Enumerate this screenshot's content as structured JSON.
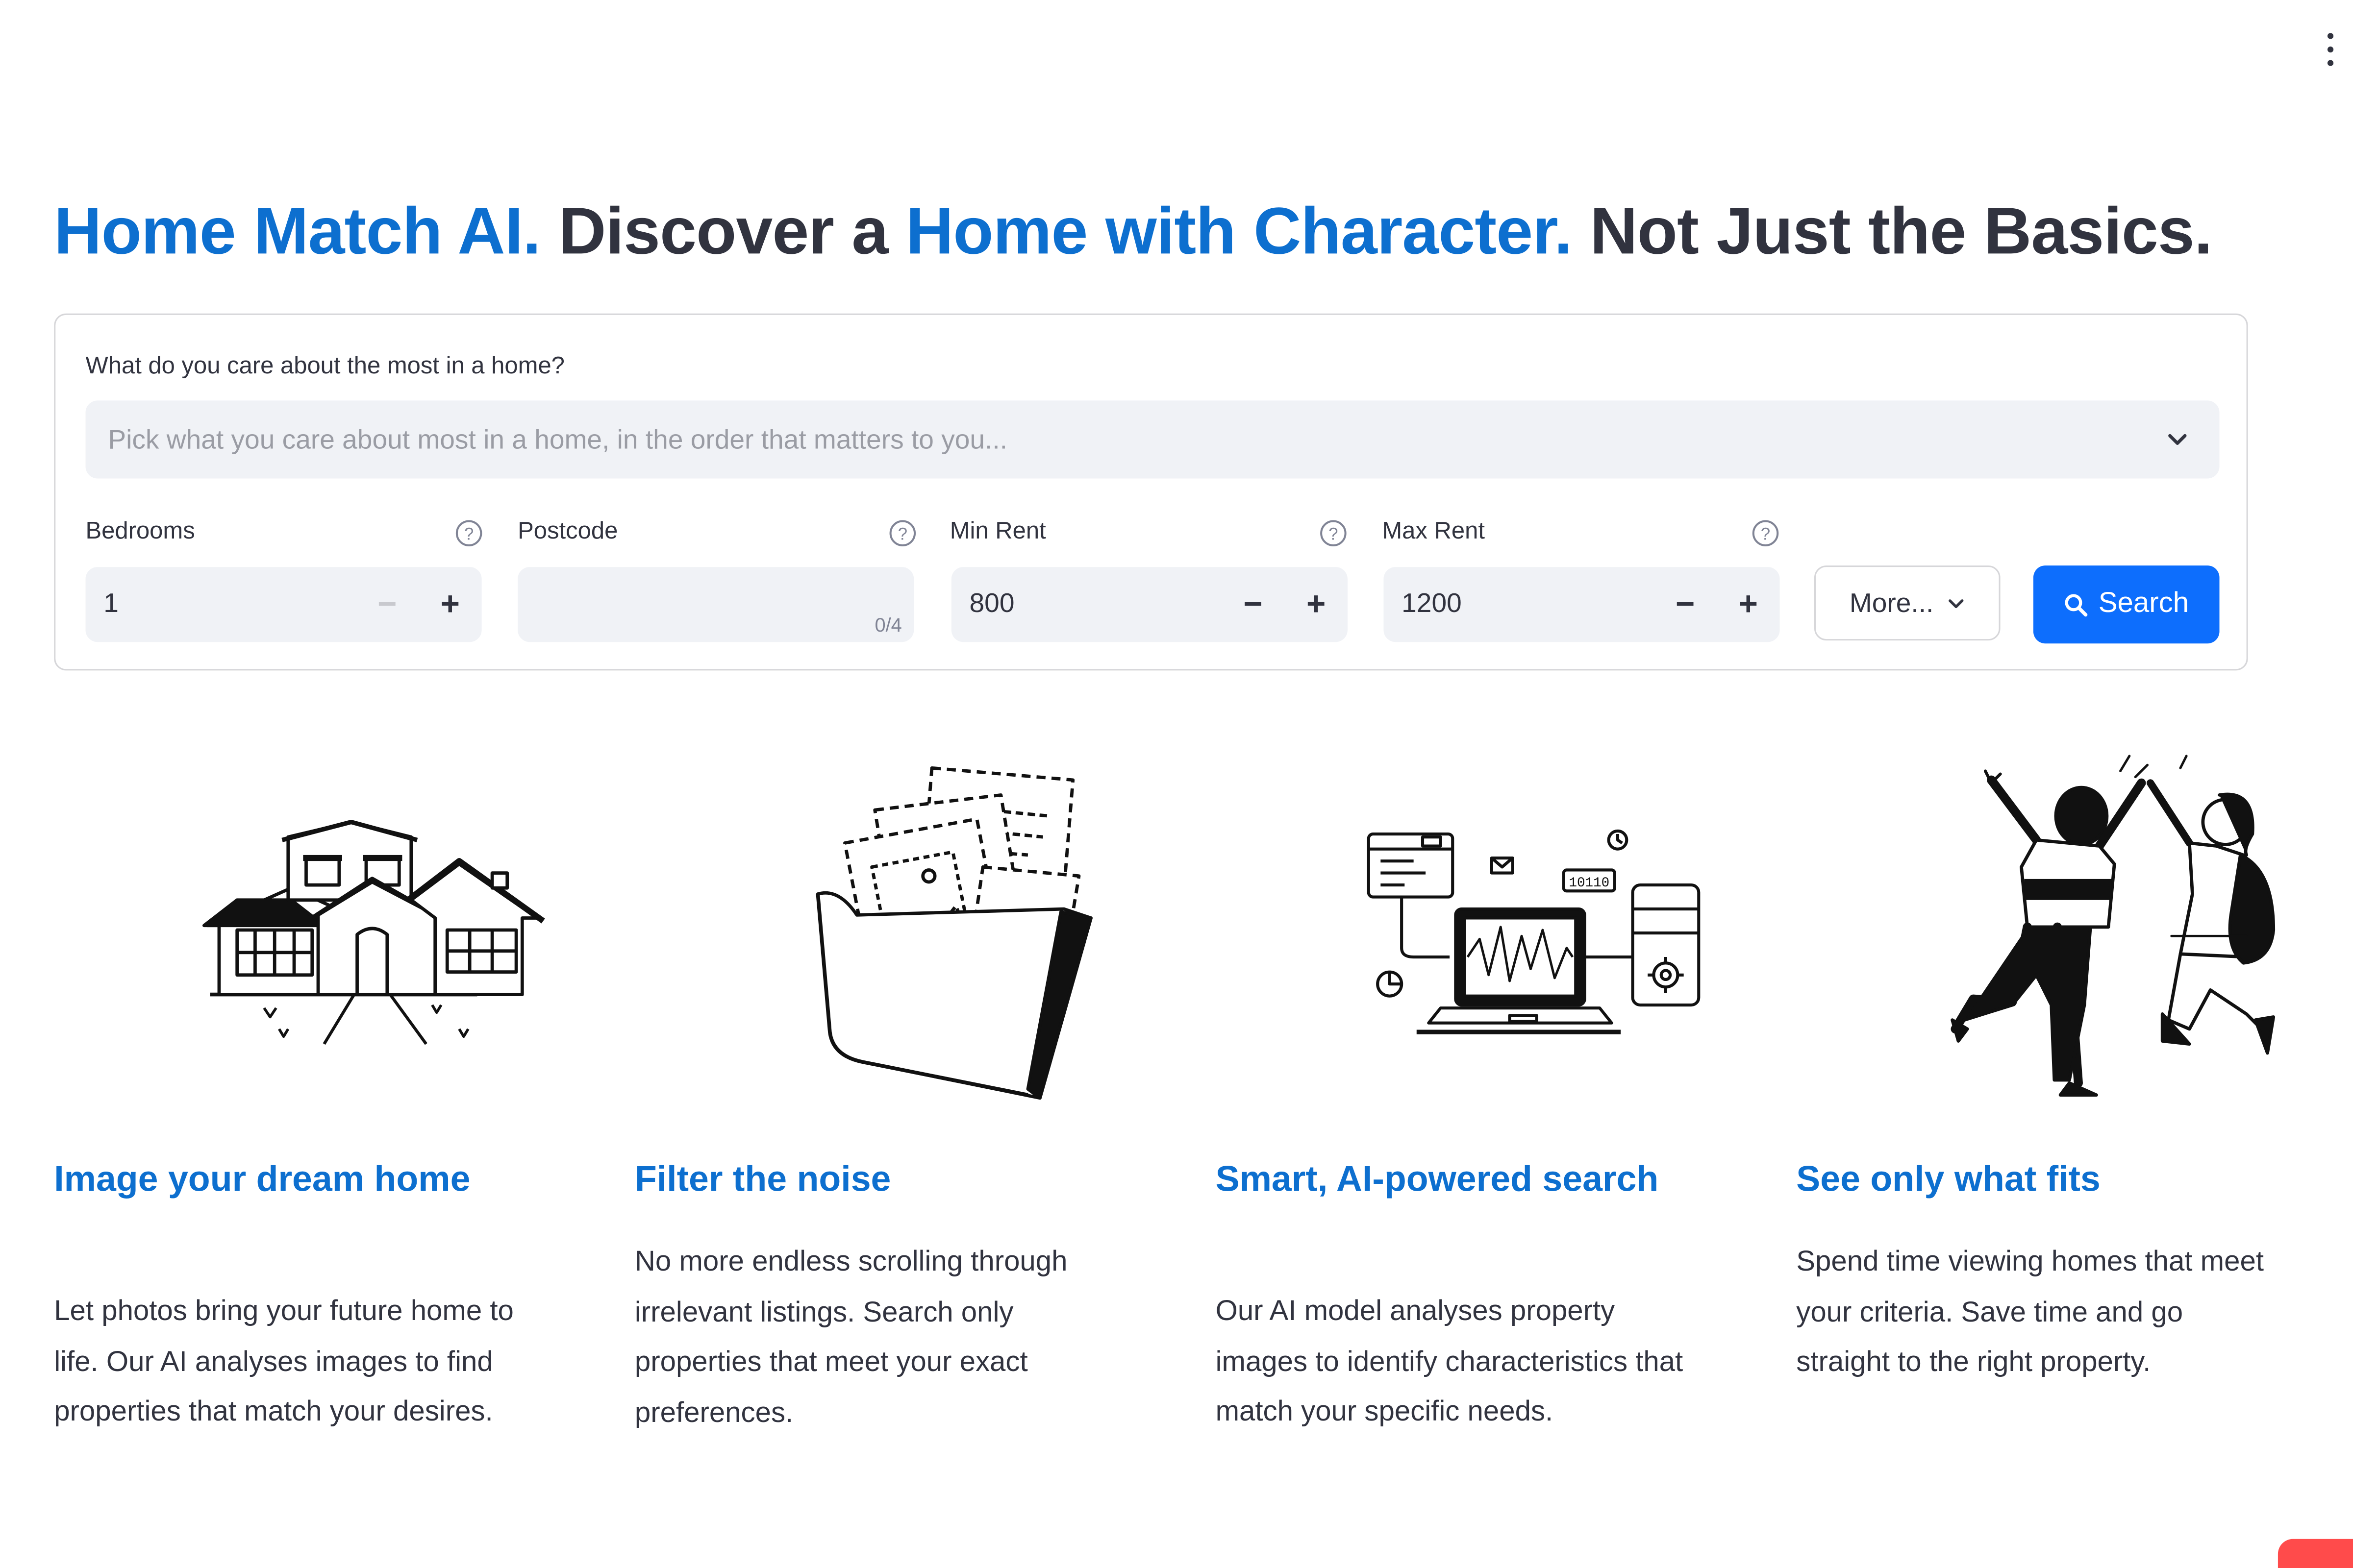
{
  "app": {
    "menu_icon": "kebab-menu-icon"
  },
  "hero": {
    "part1": "Home Match AI.",
    "part2": " Discover a ",
    "part3": "Home with Character.",
    "part4": " Not Just the Basics.",
    "accent_color": "#0d6fcf"
  },
  "form": {
    "care_label": "What do you care about the most in a home?",
    "care_placeholder": "Pick what you care about most in a home, in the order that matters to you...",
    "bedrooms": {
      "label": "Bedrooms",
      "value": "1"
    },
    "postcode": {
      "label": "Postcode",
      "value": "",
      "counter": "0/4"
    },
    "min_rent": {
      "label": "Min Rent",
      "value": "800"
    },
    "max_rent": {
      "label": "Max Rent",
      "value": "1200"
    },
    "more_label": "More...",
    "search_label": "Search",
    "search_color": "#0d6efd"
  },
  "features": [
    {
      "icon": "house-illustration",
      "title": "Image your dream home",
      "text": "Let photos bring your future home to life. Our AI analyses images to find properties that match your desires."
    },
    {
      "icon": "folder-illustration",
      "title": "Filter the noise",
      "text": "No more endless scrolling through irrelevant listings. Search only properties that meet your exact preferences."
    },
    {
      "icon": "laptop-illustration",
      "title": "Smart, AI-powered search",
      "text": "Our AI model analyses property images to identify characteristics that match your specific needs."
    },
    {
      "icon": "high-five-illustration",
      "title": "See only what fits",
      "text": "Spend time viewing homes that meet your criteria. Save time and go straight to the right property."
    }
  ]
}
